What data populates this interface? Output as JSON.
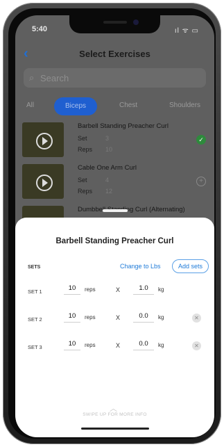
{
  "status": {
    "time": "5:40",
    "icons": "ıl ᯤ ▭"
  },
  "nav": {
    "back_icon": "‹",
    "title": "Select Exercises"
  },
  "search": {
    "placeholder": "Search"
  },
  "tabs": [
    "All",
    "Biceps",
    "Chest",
    "Shoulders"
  ],
  "active_tab": "Biceps",
  "exercises": [
    {
      "name": "Barbell Standing Preacher Curl",
      "set_label": "Set",
      "set_value": "3",
      "reps_label": "Reps",
      "reps_value": "10",
      "state": "selected"
    },
    {
      "name": "Cable One Arm Curl",
      "set_label": "Set",
      "set_value": "4",
      "reps_label": "Reps",
      "reps_value": "12",
      "state": "add"
    },
    {
      "name": "Dumbbell Standing Curl (Alternating)"
    }
  ],
  "sheet": {
    "title": "Barbell Standing Preacher Curl",
    "sets_label": "SETS",
    "change_units": "Change to Lbs",
    "add_sets": "Add sets",
    "rows": [
      {
        "label": "SET 1",
        "reps": "10",
        "reps_unit": "reps",
        "times": "X",
        "weight": "1.0",
        "unit": "kg",
        "removable": false
      },
      {
        "label": "SET 2",
        "reps": "10",
        "reps_unit": "reps",
        "times": "X",
        "weight": "0.0",
        "unit": "kg",
        "removable": true
      },
      {
        "label": "SET 3",
        "reps": "10",
        "reps_unit": "reps",
        "times": "X",
        "weight": "0.0",
        "unit": "kg",
        "removable": true
      }
    ],
    "swipe_icon": "︿",
    "swipe_hint": "SWIPE UP FOR MORE INFO"
  },
  "colors": {
    "accent": "#1e7ad8",
    "tab_active": "#1f5fd0",
    "selected_check": "#2e8a3c"
  }
}
